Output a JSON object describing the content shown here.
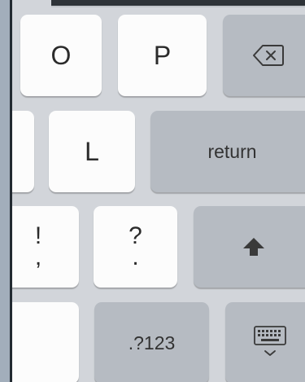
{
  "keyboard": {
    "rows": [
      {
        "keys": [
          {
            "label": "O"
          },
          {
            "label": "P"
          },
          {
            "icon": "backspace-icon"
          }
        ]
      },
      {
        "keys": [
          {
            "label": ""
          },
          {
            "label": "L"
          },
          {
            "label": "return"
          }
        ]
      },
      {
        "keys": [
          {
            "top": "!",
            "bottom": ","
          },
          {
            "top": "?",
            "bottom": "."
          },
          {
            "icon": "shift-arrow-icon"
          }
        ]
      },
      {
        "keys": [
          {
            "label": ""
          },
          {
            "label": ".?123"
          },
          {
            "icon": "keyboard-dismiss-icon"
          }
        ]
      }
    ]
  },
  "colors": {
    "keyboard_background": "#d2d5da",
    "light_key": "#fcfcfc",
    "dark_key": "#b6bbc2",
    "side_panel": "#a2aebb",
    "key_text": "#2b2b2b"
  }
}
